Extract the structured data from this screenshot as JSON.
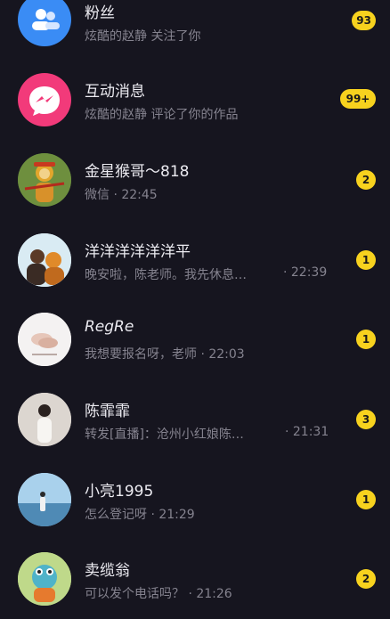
{
  "messages": [
    {
      "name": "粉丝",
      "subtitle": "炫酷的赵静 关注了你",
      "badge": "93"
    },
    {
      "name": "互动消息",
      "subtitle": "炫酷的赵静 评论了你的作品",
      "badge": "99+"
    },
    {
      "name": "金星猴哥～818",
      "subtitle": "微信 · 22:45",
      "badge": "2"
    },
    {
      "name": "洋洋洋洋洋洋平",
      "subtitle": "晚安啦，陈老师。我先休息…",
      "time": "· 22:39",
      "badge": "1"
    },
    {
      "name": "RegRe",
      "subtitle": "我想要报名呀，老师 · 22:03",
      "badge": "1"
    },
    {
      "name": "陈霏霏",
      "subtitle": "转发[直播]：沧州小红娘陈…",
      "time": "· 21:31",
      "badge": "3"
    },
    {
      "name": "小亮1995",
      "subtitle": "怎么登记呀 · 21:29",
      "badge": "1"
    },
    {
      "name": "卖缆翁",
      "subtitle": "可以发个电话吗？ · 21:26",
      "badge": "2"
    }
  ],
  "colors": {
    "background": "#16151f",
    "badge": "#f7d21e",
    "fans_icon": "#3a8cf5",
    "interaction_icon": "#f23a7a"
  },
  "icons": {
    "fans": "people-icon",
    "interaction": "lightning-chat-icon"
  }
}
